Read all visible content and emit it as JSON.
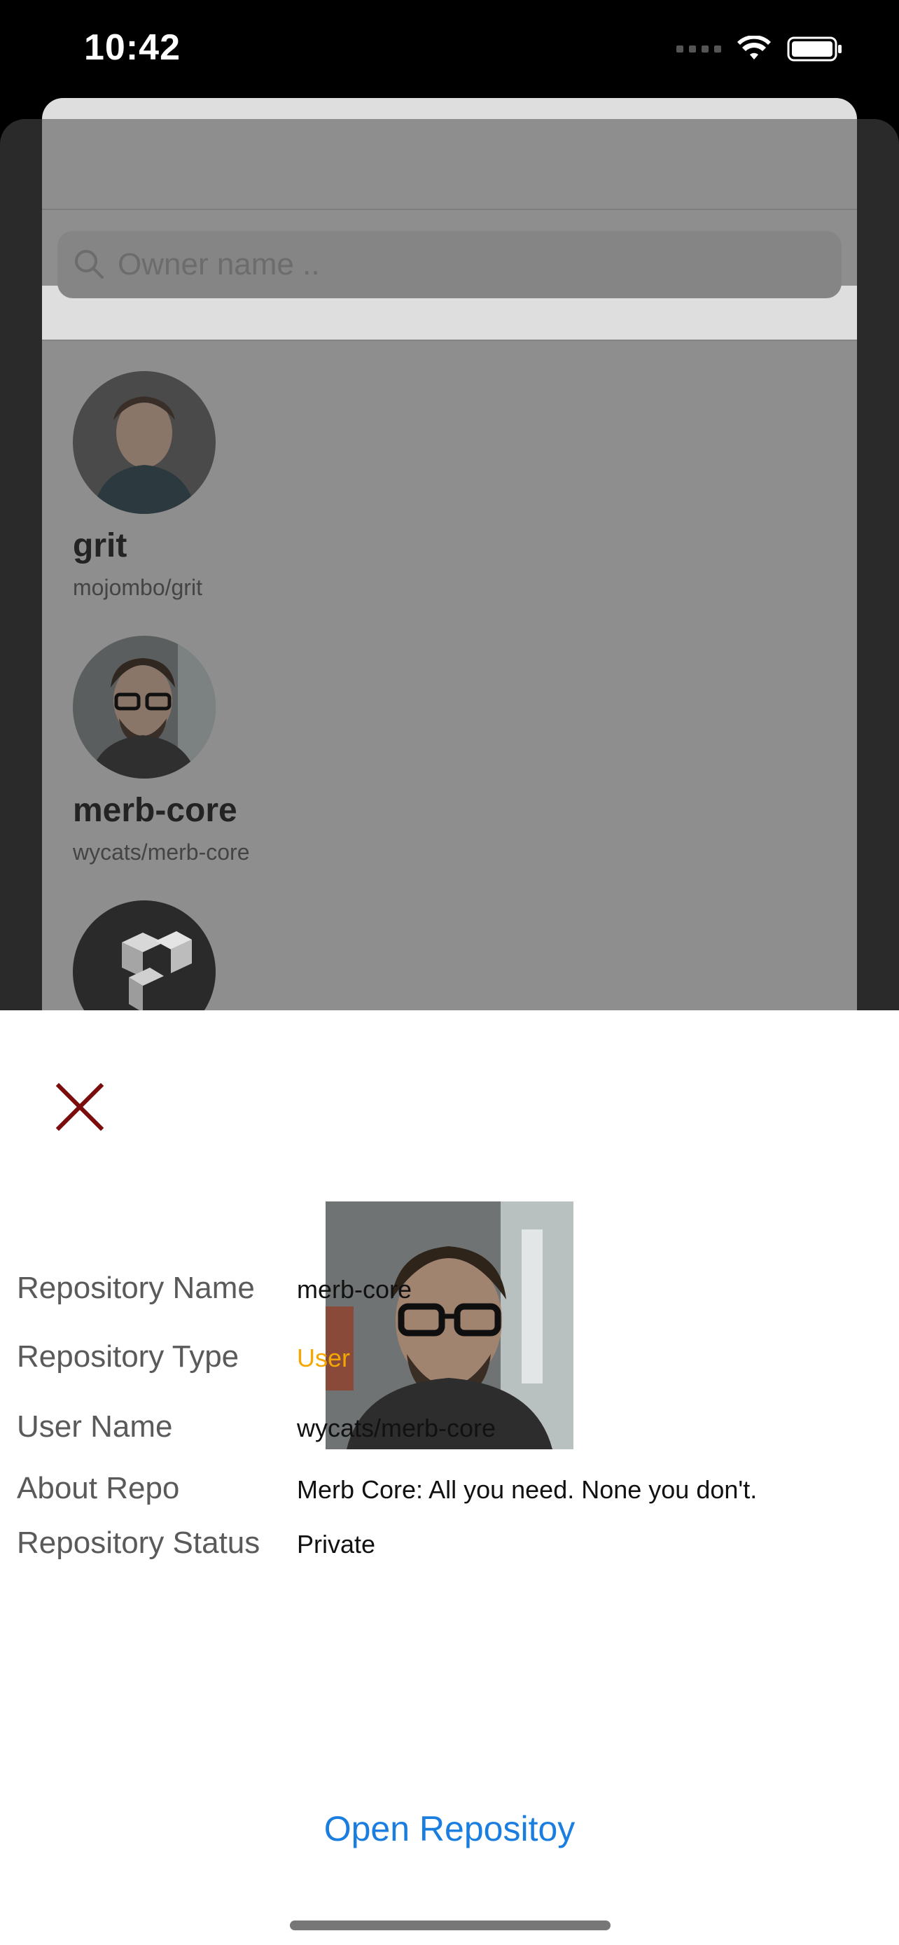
{
  "status_bar": {
    "time": "10:42"
  },
  "search": {
    "placeholder": "Owner name .."
  },
  "repo_list": [
    {
      "title": "grit",
      "subtitle": "mojombo/grit",
      "avatar_icon": "person-portrait-icon"
    },
    {
      "title": "merb-core",
      "subtitle": "wycats/merb-core",
      "avatar_icon": "person-portrait-icon"
    },
    {
      "title": "",
      "subtitle": "",
      "avatar_icon": "cube-logo-icon"
    }
  ],
  "detail": {
    "close_icon": "close-icon",
    "fields": [
      {
        "label": "Repository Name",
        "value": "merb-core"
      },
      {
        "label": "Repository Type",
        "value": "User"
      },
      {
        "label": "User Name",
        "value": "wycats/merb-core"
      },
      {
        "label": "About Repo",
        "value": "Merb Core: All you need. None you don't."
      },
      {
        "label": "Repository Status",
        "value": "Private"
      }
    ],
    "open_link": "Open Repositoy"
  },
  "colors": {
    "accent_type": "#f4a700",
    "link": "#1a7ee0",
    "close": "#7a0c0c"
  }
}
